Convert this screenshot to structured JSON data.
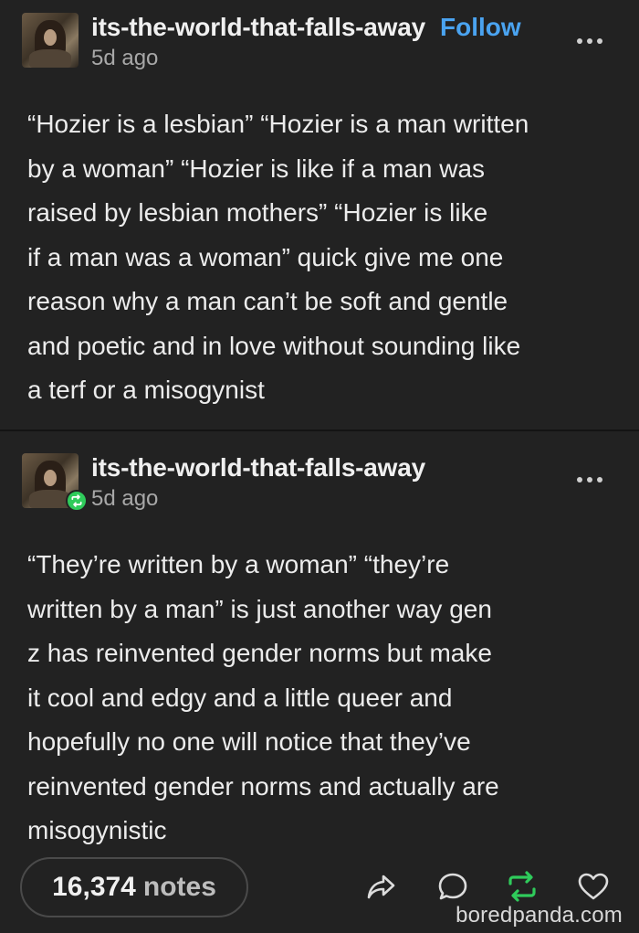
{
  "posts": [
    {
      "username": "its-the-world-that-falls-away",
      "follow_label": "Follow",
      "time": "5d ago",
      "lines": [
        "“Hozier is a lesbian” “Hozier is a man written",
        "by a woman” “Hozier is like if a man was",
        "raised by lesbian mothers” “Hozier is like",
        "if a man was a woman” quick give me one",
        "reason why a man can’t be soft and gentle",
        "and poetic and in love without sounding like",
        "a terf or a misogynist"
      ]
    },
    {
      "username": "its-the-world-that-falls-away",
      "time": "5d ago",
      "reblog_badge_icon": "reblog-icon",
      "lines": [
        "“They’re written by a woman” “they’re",
        "written by a man” is just another way gen",
        "z has reinvented gender norms but make",
        "it cool and edgy and a little queer and",
        "hopefully no one will notice that they’ve",
        "reinvented gender norms and actually are",
        "misogynistic"
      ]
    }
  ],
  "footer": {
    "notes_count": "16,374",
    "notes_label": "notes",
    "actions": [
      "share-icon",
      "reply-icon",
      "reblog-icon",
      "like-icon"
    ],
    "reblog_color": "#2fcb5b"
  },
  "watermark": "boredpanda.com",
  "colors": {
    "background": "#222222",
    "follow": "#4aa3f0",
    "reblog": "#2fcb5b"
  }
}
